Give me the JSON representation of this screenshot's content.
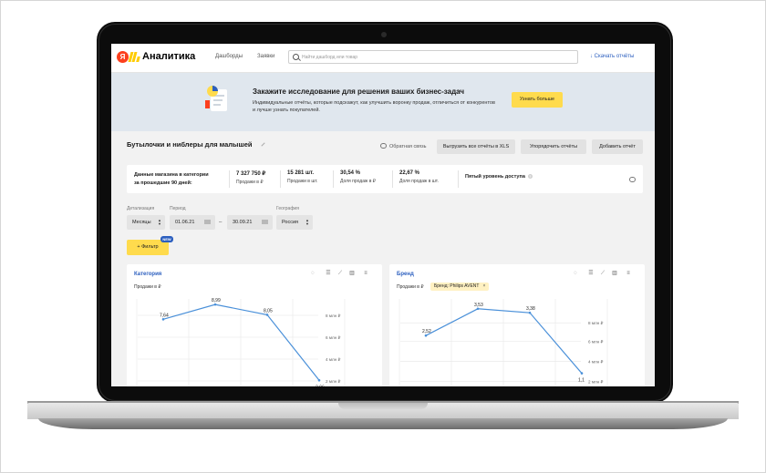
{
  "app": {
    "logo_letter": "Я",
    "title": "Аналитика",
    "nav": [
      "Дашборды",
      "Заявки"
    ],
    "search_placeholder": "Найти дашборд или товар",
    "download_label": "Скачать отчёты",
    "accent_color": "#2c5fbf",
    "brand_yellow": "#ffdb4d"
  },
  "banner": {
    "title": "Закажите исследование для решения ваших бизнес-задач",
    "subtitle": "Индивидуальные отчёты, которые подскажут, как улучшить воронку продаж, отличиться от конкурентов и лучше узнать покупателей.",
    "button": "Узнать больше"
  },
  "page": {
    "title": "Бутылочки и ниблеры для малышей",
    "feedback": "Обратная связь",
    "actions": [
      "Выгрузить все отчёты в XLS",
      "Упорядочить отчёты",
      "Добавить отчёт"
    ]
  },
  "stats": {
    "label_line1": "Данные магазина в категории",
    "label_line2": "за прошедшие 90 дней:",
    "items": [
      {
        "value": "7 327 750 ₽",
        "label": "Продажи в ₽"
      },
      {
        "value": "15 281 шт.",
        "label": "Продажи в шт."
      },
      {
        "value": "30,54 %",
        "label": "Доля продаж в ₽"
      },
      {
        "value": "22,67 %",
        "label": "Доля продаж в шт."
      }
    ],
    "access": "Пятый уровень доступа",
    "access_help": "?"
  },
  "filters": {
    "detail_label": "Детализация",
    "detail_value": "Месяцы",
    "period_label": "Период",
    "date_from": "01.06.21",
    "date_sep": "–",
    "date_to": "30.09.21",
    "geo_label": "География",
    "geo_value": "Россия",
    "filter_button": "+ Фильтр",
    "new_badge": "NEW"
  },
  "cards": [
    {
      "title": "Категория",
      "subtitle": "Продажи в ₽",
      "tag": "",
      "chart_data": {
        "type": "line",
        "ylabel": "Продажи в ₽",
        "series": [
          {
            "values": [
              7.64,
              8.99,
              8.05,
              2.06
            ]
          }
        ],
        "data_labels": [
          "7,64",
          "8,99",
          "8,05",
          "2,06"
        ],
        "ylim": [
          1,
          9.5
        ],
        "y_ticks": [
          {
            "v": 8,
            "label": "8 млн ₽"
          },
          {
            "v": 6,
            "label": "6 млн ₽"
          },
          {
            "v": 4,
            "label": "4 млн ₽"
          },
          {
            "v": 2,
            "label": "2 млн ₽"
          }
        ],
        "grid": true
      }
    },
    {
      "title": "Бренд",
      "subtitle": "Продажи в ₽",
      "tag": "Бренд: Philips AVENT",
      "tag_close": "×",
      "chart_data": {
        "type": "line",
        "ylabel": "Продажи в ₽",
        "series": [
          {
            "name": "Бренд: Philips AVENT",
            "values": [
              2.52,
              3.53,
              3.38,
              1.1
            ]
          }
        ],
        "data_labels": [
          "2,52",
          "3,53",
          "3,38",
          "1,1"
        ],
        "ylim": [
          0.4,
          3.9
        ],
        "y_ticks": [
          {
            "v": 3,
            "label": "8 млн ₽"
          },
          {
            "v": 2.3,
            "label": "6 млн ₽"
          },
          {
            "v": 1.55,
            "label": "4 млн ₽"
          },
          {
            "v": 0.8,
            "label": "2 млн ₽"
          }
        ],
        "grid": true
      }
    }
  ]
}
